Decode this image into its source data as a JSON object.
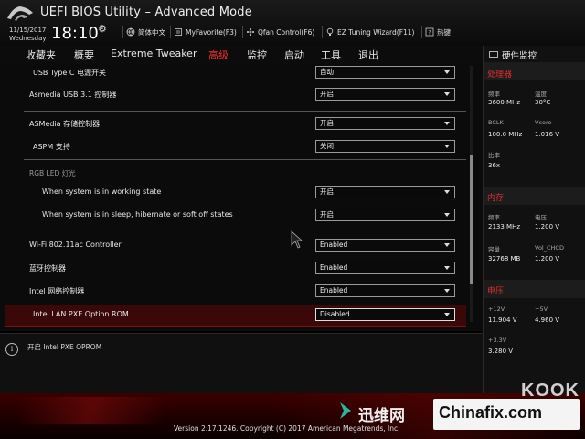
{
  "header": {
    "title": "UEFI BIOS Utility – Advanced Mode",
    "date_line1": "11/15/2017",
    "date_line2": "Wednesday",
    "time": "18:10",
    "items": [
      {
        "label": "简体中文",
        "icon": "globe-icon"
      },
      {
        "label": "MyFavorite(F3)",
        "icon": "favorite-icon"
      },
      {
        "label": "Qfan Control(F6)",
        "icon": "fan-icon"
      },
      {
        "label": "EZ Tuning Wizard(F11)",
        "icon": "bulb-icon"
      },
      {
        "label": "热键",
        "icon": "hotkey-icon"
      }
    ]
  },
  "menu": {
    "items": [
      "收藏夹",
      "概要",
      "Extreme Tweaker",
      "高级",
      "监控",
      "启动",
      "工具",
      "退出"
    ],
    "active_index": 3
  },
  "settings": {
    "rows": [
      {
        "label": "USB Type C 电源开关",
        "value": "自动"
      },
      {
        "label": "Asmedia USB 3.1 控制器",
        "value": "开启"
      },
      {
        "label": "ASMedia 存储控制器",
        "value": "开启"
      },
      {
        "label": "ASPM 支持",
        "value": "关闭"
      },
      {
        "label": "When system is in working state",
        "value": "开启"
      },
      {
        "label": "When system is in sleep, hibernate or soft off states",
        "value": "开启"
      },
      {
        "label": "Wi-Fi 802.11ac Controller",
        "value": "Enabled"
      },
      {
        "label": "蓝牙控制器",
        "value": "Enabled"
      },
      {
        "label": "Intel 网络控制器",
        "value": "Enabled"
      },
      {
        "label": "Intel LAN PXE Option ROM",
        "value": "Disabled"
      }
    ],
    "group_label": "RGB LED 灯光",
    "selected_index": 9
  },
  "help": {
    "text": "开启 Intel PXE OPROM"
  },
  "hwmon": {
    "title": "硬件监控",
    "cpu": {
      "section": "处理器",
      "freq_label": "频率",
      "freq_value": "3600 MHz",
      "temp_label": "温度",
      "temp_value": "30°C",
      "bclk_label": "BCLK",
      "bclk_value": "100.0 MHz",
      "vcore_label": "Vcore",
      "vcore_value": "1.016 V",
      "ratio_label": "比率",
      "ratio_value": "36x"
    },
    "memory": {
      "section": "内存",
      "freq_label": "频率",
      "freq_value": "2133 MHz",
      "volt_label": "电压",
      "volt_value": "1.200 V",
      "cap_label": "容量",
      "cap_value": "32768 MB",
      "vol_chcd_label": "Vol_CHCD",
      "vol_chcd_value": "1.200 V"
    },
    "voltage": {
      "section": "电压",
      "v12_label": "+12V",
      "v12_value": "11.904 V",
      "v5_label": "+5V",
      "v5_value": "4.960 V",
      "v33_label": "+3.3V",
      "v33_value": "3.280 V"
    }
  },
  "footer": {
    "version": "Version 2.17.1246. Copyright (C) 2017 American Megatrends, Inc."
  },
  "watermarks": {
    "xunwei": "迅维网",
    "chinafix": "Chinafix.com",
    "kook": "KOOK"
  },
  "colors": {
    "accent_red": "#f03030",
    "selected_row": "#3a0808"
  }
}
